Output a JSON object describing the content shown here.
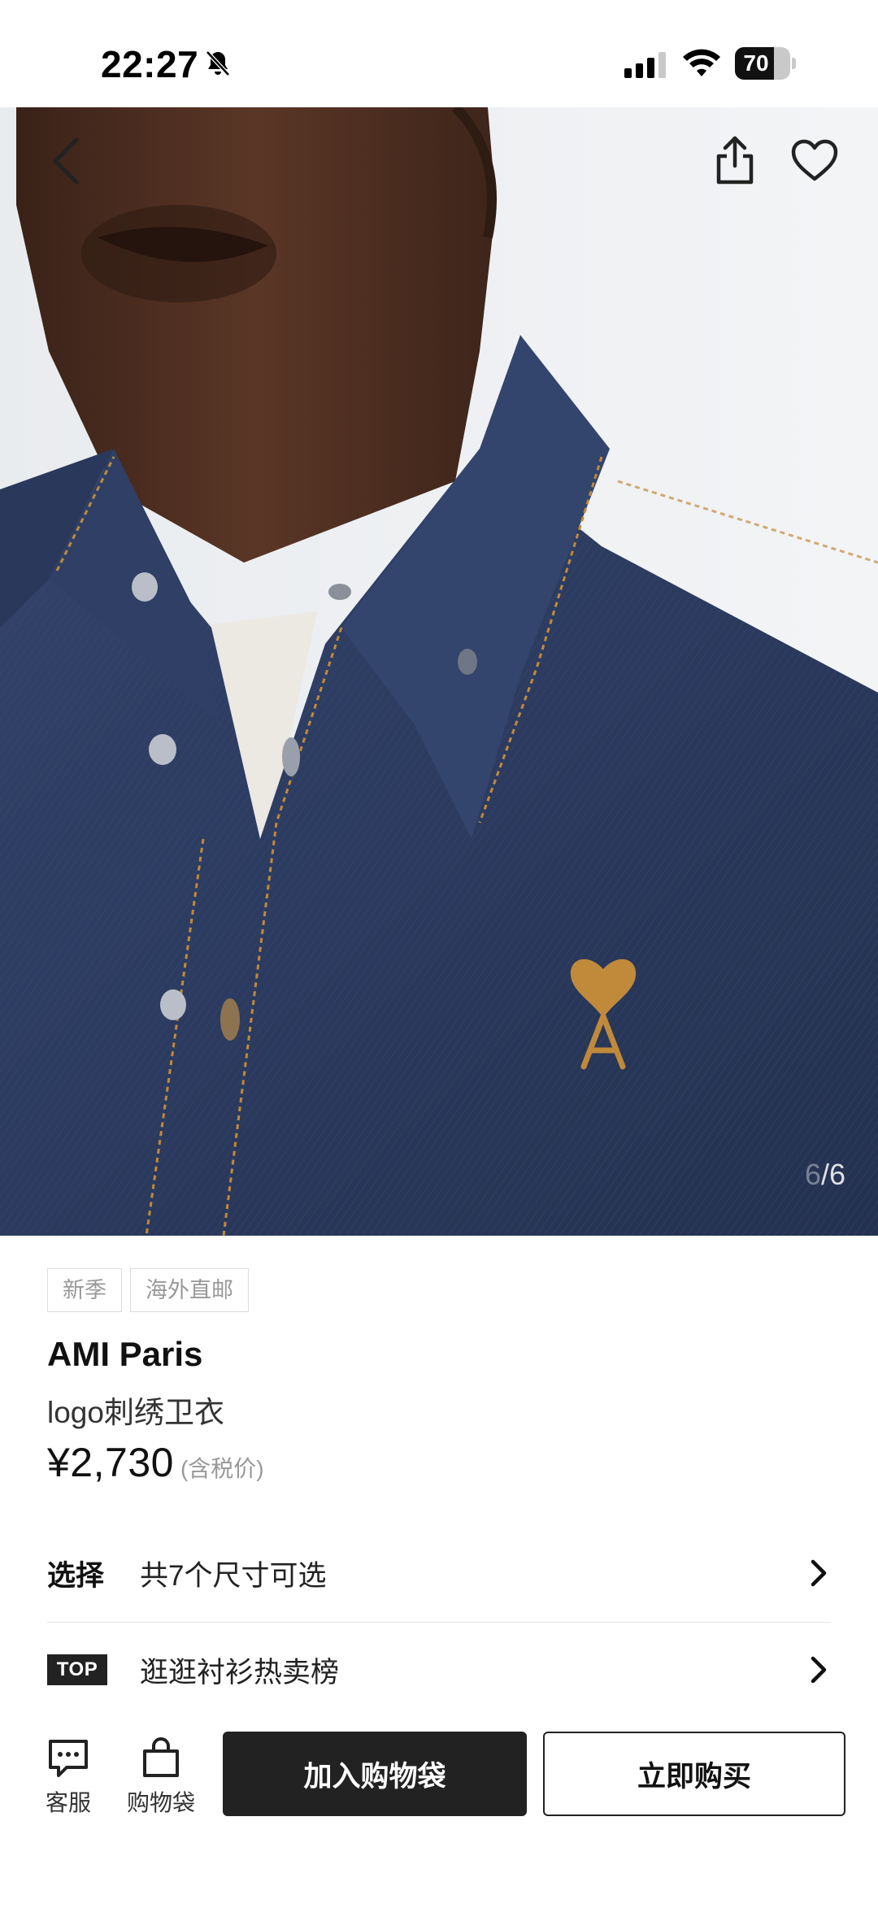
{
  "status_bar": {
    "time": "22:27",
    "battery": "70",
    "battery_level": 0.7,
    "icons": [
      "bell-slash-icon",
      "signal-icon",
      "wifi-icon",
      "battery-icon"
    ]
  },
  "gallery": {
    "nav_icons": [
      "back-chevron-icon",
      "share-icon",
      "heart-icon"
    ],
    "current": "6",
    "separator_total": "/6"
  },
  "product": {
    "tags": [
      "新季",
      "海外直邮"
    ],
    "brand": "AMI Paris",
    "name": "logo刺绣卫衣",
    "price": "¥2,730",
    "price_note": "(含税价)"
  },
  "options": {
    "select_label": "选择",
    "select_text": "共7个尺寸可选",
    "top_badge": "TOP",
    "ranking_text": "逛逛衬衫热卖榜"
  },
  "bottom_bar": {
    "service_label": "客服",
    "bag_label": "购物袋",
    "add_to_bag": "加入购物袋",
    "buy_now": "立即购买"
  },
  "colors": {
    "denim": "#2b3a5e",
    "stitch": "#c08a3a",
    "primary_button": "#222222"
  }
}
